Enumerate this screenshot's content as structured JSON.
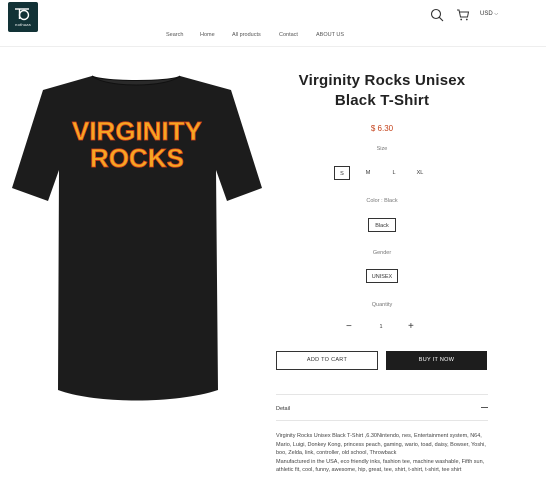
{
  "header": {
    "logo_text": "nothuza",
    "currency": "USD",
    "nav": [
      "Search",
      "Home",
      "All products",
      "Contact",
      "ABOUT US"
    ]
  },
  "product": {
    "image_text_line1": "VIRGINITY",
    "image_text_line2": "ROCKS",
    "title": "Virginity Rocks Unisex Black T-Shirt",
    "price": "$ 6.30",
    "size_label": "Size",
    "sizes": [
      "S",
      "M",
      "L",
      "XL"
    ],
    "selected_size": "S",
    "color_label": "Color : Black",
    "color_value": "Black",
    "gender_label": "Gender",
    "gender_value": "UNISEX",
    "quantity_label": "Quantity",
    "quantity": "1",
    "add_to_cart": "ADD TO CART",
    "buy_now": "BUY IT NOW",
    "detail_label": "Detail",
    "description_1": "Virginity Rocks Unisex Black T-Shirt ,6.30Nintendo, nes, Entertainment system, N64, Mario, Luigi, Donkey Kong, princess peach, gaming, wario, toad, daisy, Bowser, Yoshi, boo, Zelda, link, controller, old school, Throwback",
    "description_2": "Manufactured in the USA, eco friendly inks, fashion tee, machine washable, Fifth sun, athletic fit, cool, funny, awesome, hip, great, tee, shirt, t-shirt, t-shirt, tee shirt"
  },
  "colors": {
    "accent_price": "#c4411a",
    "buy_button": "#1d1d1d",
    "shirt": "#1c1c1c",
    "print_fill": "#f5a623"
  }
}
